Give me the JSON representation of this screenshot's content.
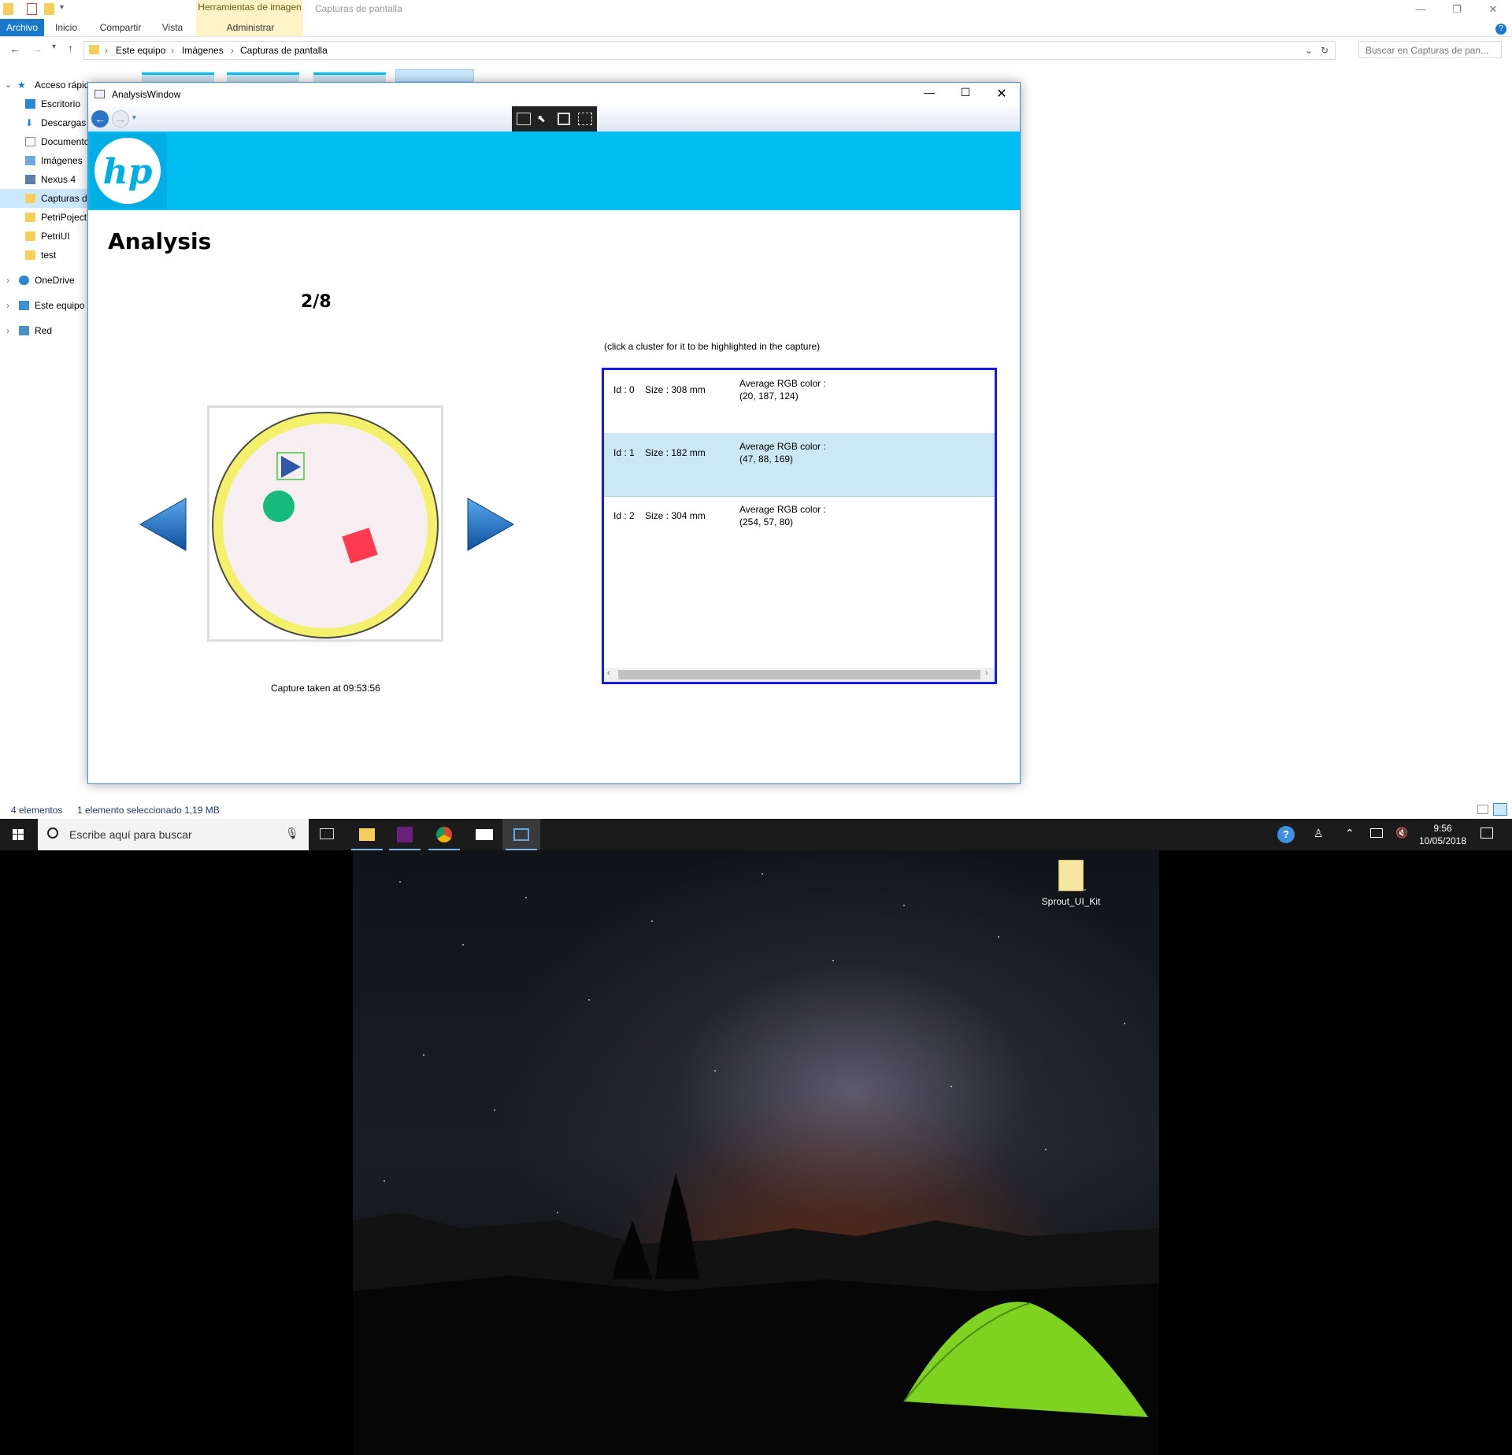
{
  "explorer": {
    "window_caption": "Capturas de pantalla",
    "context_tab_group": "Herramientas de imagen",
    "tabs": [
      {
        "label": "Archivo"
      },
      {
        "label": "Inicio"
      },
      {
        "label": "Compartir"
      },
      {
        "label": "Vista"
      },
      {
        "label": "Administrar"
      }
    ],
    "breadcrumb": [
      "Este equipo",
      "Imágenes",
      "Capturas de pantalla"
    ],
    "search_placeholder": "Buscar en Capturas de pan...",
    "nav_items": [
      {
        "label": "Acceso rápido",
        "icon": "star-icon"
      },
      {
        "label": "Escritorio",
        "icon": "desktop-folder-icon"
      },
      {
        "label": "Descargas",
        "icon": "download-icon"
      },
      {
        "label": "Documentos",
        "icon": "document-icon"
      },
      {
        "label": "Imágenes",
        "icon": "pictures-icon"
      },
      {
        "label": "Nexus 4",
        "icon": "device-icon"
      },
      {
        "label": "Capturas de pantalla",
        "icon": "folder-icon"
      },
      {
        "label": "PetriPoject",
        "icon": "folder-icon"
      },
      {
        "label": "PetriUI",
        "icon": "folder-icon"
      },
      {
        "label": "test",
        "icon": "folder-icon"
      },
      {
        "label": "OneDrive",
        "icon": "cloud-icon"
      },
      {
        "label": "Este equipo",
        "icon": "computer-icon"
      },
      {
        "label": "Red",
        "icon": "network-icon"
      }
    ],
    "status_count": "4 elementos",
    "status_selection": "1 elemento seleccionado  1,19 MB"
  },
  "analysis": {
    "window_title": "AnalysisWindow",
    "heading": "Analysis",
    "counter": "2/8",
    "hint": "(click a cluster for it to be highlighted in the capture)",
    "caption": "Capture taken at 09:53:56",
    "clusters": [
      {
        "id": "Id : 0",
        "size": "Size : 308 mm",
        "color_label": "Average RGB color :",
        "rgb": "(20, 187, 124)"
      },
      {
        "id": "Id : 1",
        "size": "Size : 182 mm",
        "color_label": "Average RGB color :",
        "rgb": "(47, 88, 169)"
      },
      {
        "id": "Id : 2",
        "size": "Size : 304 mm",
        "color_label": "Average RGB color :",
        "rgb": "(254, 57, 80)"
      }
    ],
    "selected_cluster_index": 1,
    "colors": {
      "banner": "#00bef2",
      "list_border": "#1919e6",
      "selected_row": "#cce8f4"
    }
  },
  "taskbar": {
    "search_placeholder": "Escribe aquí para buscar",
    "apps": [
      "file-explorer-icon",
      "visual-studio-icon",
      "chrome-icon",
      "mail-icon",
      "app-window-icon"
    ],
    "time": "9:56",
    "date": "10/05/2018"
  },
  "desktop": {
    "icon_label": "Sprout_UI_Kit"
  }
}
